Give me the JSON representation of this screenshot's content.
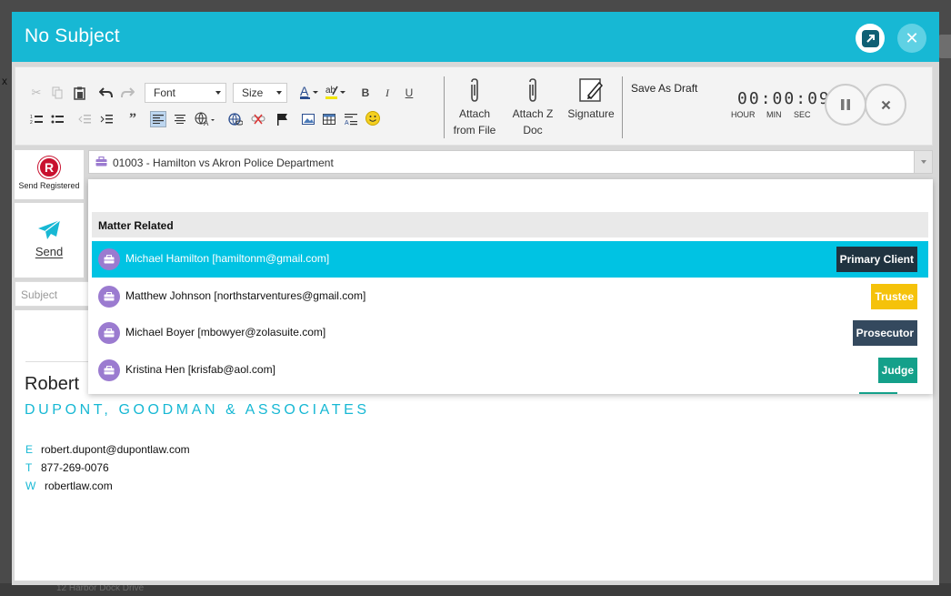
{
  "window": {
    "title": "No Subject"
  },
  "toolbar": {
    "font_label": "Font",
    "size_label": "Size",
    "attach_file_label_1": "Attach",
    "attach_file_label_2": "from File",
    "attach_z_label_1": "Attach Z",
    "attach_z_label_2": "Doc",
    "signature_label": "Signature",
    "save_draft_label": "Save As Draft"
  },
  "timer": {
    "hours": "00",
    "minutes": "00",
    "seconds": "09",
    "hour_label": "HOUR",
    "min_label": "MIN",
    "sec_label": "SEC"
  },
  "left_actions": {
    "registered_logo": "R",
    "registered_label": "Send Registered",
    "send_label": "Send"
  },
  "matter": {
    "selected": "01003 - Hamilton vs Akron Police Department"
  },
  "subject": {
    "placeholder": "Subject"
  },
  "dropdown": {
    "header": "Matter Related",
    "items": [
      {
        "name": "Michael Hamilton [hamiltonm@gmail.com]",
        "role": "Primary Client",
        "role_color": "#1f3340",
        "selected": true
      },
      {
        "name": "Matthew Johnson [northstarventures@gmail.com]",
        "role": "Trustee",
        "role_color": "#f5c20a",
        "selected": false
      },
      {
        "name": "Michael Boyer [mbowyer@zolasuite.com]",
        "role": "Prosecutor",
        "role_color": "#34495e",
        "selected": false
      },
      {
        "name": "Kristina Hen [krisfab@aol.com]",
        "role": "Judge",
        "role_color": "#14a08a",
        "selected": false
      }
    ]
  },
  "signature": {
    "name": "Robert",
    "firm": "DUPONT, GOODMAN & ASSOCIATES",
    "email_key": "E",
    "email": "robert.dupont@dupontlaw.com",
    "phone_key": "T",
    "phone": "877-269-0076",
    "web_key": "W",
    "web": "robertlaw.com"
  },
  "background": {
    "left_fragment": "x",
    "bottom_fragment": "12 Harbor Dock Drive"
  },
  "colors": {
    "accent": "#17b8d4",
    "selected_row": "#00c3e3",
    "avatar": "#9b7bd0"
  }
}
